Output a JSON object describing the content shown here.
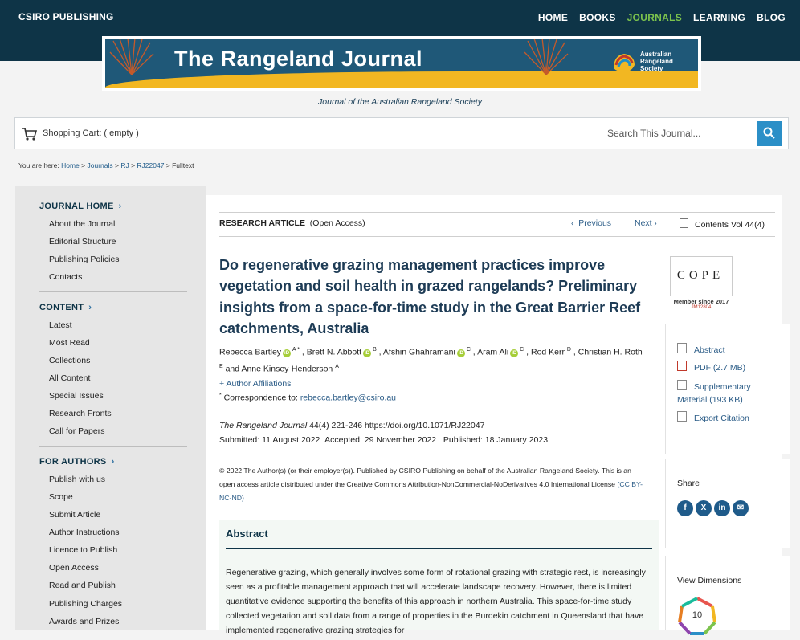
{
  "header": {
    "brand": "CSIRO PUBLISHING",
    "nav": [
      "HOME",
      "BOOKS",
      "JOURNALS",
      "LEARNING",
      "BLOG"
    ],
    "active_nav": "JOURNALS"
  },
  "banner": {
    "title": "The Rangeland Journal",
    "logo_lines": [
      "Australian",
      "Rangeland",
      "Society"
    ]
  },
  "subtitle": "Journal of the Australian Rangeland Society",
  "cart": {
    "label": "Shopping Cart: ( empty )"
  },
  "search": {
    "placeholder": "Search This Journal..."
  },
  "breadcrumb": {
    "prefix": "You are here:",
    "items": [
      "Home",
      "Journals",
      "RJ",
      "RJ22047"
    ],
    "current": "Fulltext"
  },
  "sidebar": {
    "journal_home": {
      "heading": "JOURNAL HOME",
      "items": [
        "About the Journal",
        "Editorial Structure",
        "Publishing Policies",
        "Contacts"
      ]
    },
    "content": {
      "heading": "CONTENT",
      "items": [
        "Latest",
        "Most Read",
        "Collections",
        "All Content",
        "Special Issues",
        "Research Fronts",
        "Call for Papers"
      ]
    },
    "for_authors": {
      "heading": "FOR AUTHORS",
      "items": [
        "Publish with us",
        "Scope",
        "Submit Article",
        "Author Instructions",
        "Licence to Publish",
        "Open Access",
        "Read and Publish",
        "Publishing Charges",
        "Awards and Prizes"
      ]
    }
  },
  "article": {
    "type": "RESEARCH ARTICLE",
    "access": "(Open Access)",
    "prev": "Previous",
    "next": "Next",
    "contents": "Contents Vol 44(4)",
    "title": "Do regenerative grazing management practices improve vegetation and soil health in grazed rangelands? Preliminary insights from a space-for-time study in the Great Barrier Reef catchments, Australia",
    "authors": [
      {
        "name": "Rebecca Bartley",
        "orcid": true,
        "aff": "A *"
      },
      {
        "name": "Brett N. Abbott",
        "orcid": true,
        "aff": "B"
      },
      {
        "name": "Afshin Ghahramani",
        "orcid": true,
        "aff": "C"
      },
      {
        "name": "Aram Ali",
        "orcid": true,
        "aff": "C"
      },
      {
        "name": "Rod Kerr",
        "orcid": false,
        "aff": "D"
      },
      {
        "name": "Christian H. Roth",
        "orcid": false,
        "aff": "E"
      },
      {
        "name": "Anne Kinsey-Henderson",
        "orcid": false,
        "aff": "A"
      }
    ],
    "affiliations_link": "+ Author Affiliations",
    "correspondence_label": "Correspondence to:",
    "correspondence_email": "rebecca.bartley@csiro.au",
    "journal": "The Rangeland Journal",
    "citation": "44(4) 221-246 https://doi.org/10.1071/RJ22047",
    "submitted": "Submitted: 11 August 2022",
    "accepted": "Accepted: 29 November 2022",
    "published": "Published: 18 January 2023",
    "license_text": "© 2022 The Author(s) (or their employer(s)). Published by CSIRO Publishing on behalf of the Australian Rangeland Society. This is an open access article distributed under the Creative Commons Attribution-NonCommercial-NoDerivatives 4.0 International License",
    "license_link": "(CC BY-NC-ND)",
    "abstract_title": "Abstract",
    "abstract_text": "Regenerative grazing, which generally involves some form of rotational grazing with strategic rest, is increasingly seen as a profitable management approach that will accelerate landscape recovery. However, there is limited quantitative evidence supporting the benefits of this approach in northern Australia. This space-for-time study collected vegetation and soil data from a range of properties in the Burdekin catchment in Queensland that have implemented regenerative grazing strategies for"
  },
  "cope": {
    "letters": "COPE",
    "caption": "Member since 2017",
    "id": "JM12804"
  },
  "right_panel": {
    "links": [
      "Abstract",
      "PDF (2.7 MB)",
      "Supplementary Material (193 KB)",
      "Export Citation"
    ],
    "share_label": "Share",
    "share_icons": [
      "f",
      "X",
      "in",
      "✉"
    ],
    "dimensions_label": "View Dimensions",
    "dimensions_score": "10"
  },
  "colors": {
    "header_bg": "#0e3447",
    "active_nav": "#7cc34d",
    "link": "#2b5c87",
    "search_button": "#2b8fc7"
  }
}
